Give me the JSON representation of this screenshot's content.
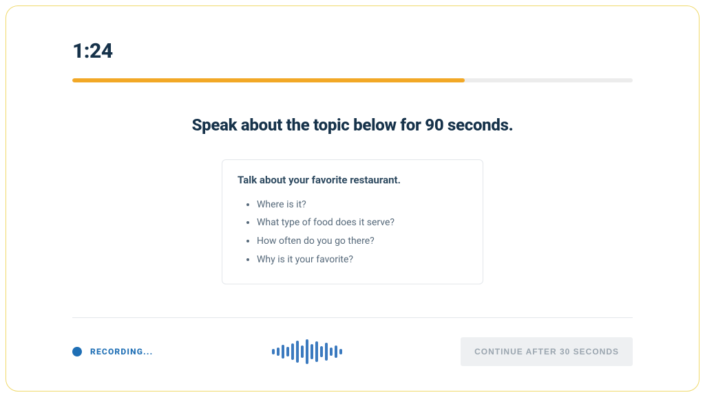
{
  "timer": "1:24",
  "progress_percent": 70,
  "instruction": "Speak about the topic below for 90 seconds.",
  "prompt": {
    "title": "Talk about your favorite restaurant.",
    "bullets": [
      "Where is it?",
      "What type of food does it serve?",
      "How often do you go there?",
      "Why is it your favorite?"
    ]
  },
  "recording_label": "RECORDING...",
  "continue_label": "CONTINUE AFTER 30 SECONDS",
  "waveform_heights": [
    8,
    12,
    20,
    14,
    24,
    32,
    18,
    36,
    22,
    30,
    16,
    26,
    12,
    18,
    8
  ],
  "colors": {
    "accent_orange": "#f2a826",
    "accent_blue": "#1f6fb5",
    "text_dark": "#16324a"
  }
}
